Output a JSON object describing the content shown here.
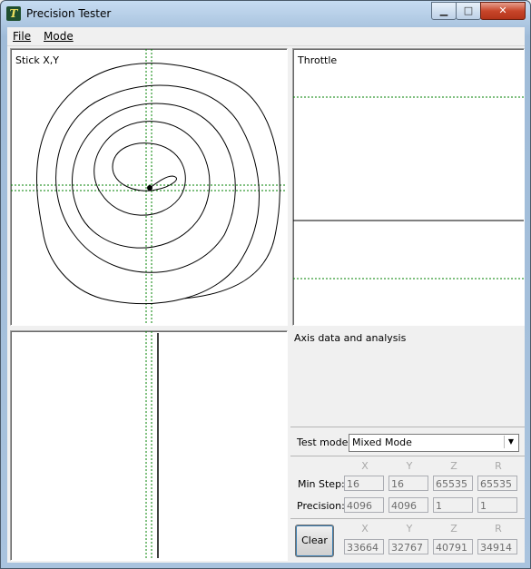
{
  "window": {
    "title": "Precision Tester",
    "icon": "app-icon",
    "caption_buttons": {
      "minimize": "▁",
      "maximize": "□",
      "close": "✕"
    }
  },
  "menu": {
    "file": "File",
    "mode": "Mode"
  },
  "panels": {
    "stick": {
      "label": "Stick X,Y"
    },
    "throttle": {
      "label": "Throttle"
    },
    "analysis": {
      "label": "Axis data and analysis"
    }
  },
  "test_mode": {
    "label": "Test mode:",
    "value": "Mixed Mode"
  },
  "stats": {
    "columns": [
      "X",
      "Y",
      "Z",
      "R"
    ],
    "min_step": {
      "label": "Min Step:",
      "values": [
        "16",
        "16",
        "65535",
        "65535"
      ]
    },
    "precision": {
      "label": "Precision:",
      "values": [
        "4096",
        "4096",
        "1",
        "1"
      ]
    }
  },
  "raw": {
    "columns": [
      "X",
      "Y",
      "Z",
      "R"
    ],
    "values": [
      "33664",
      "32767",
      "40791",
      "34914"
    ]
  },
  "clear_button": "Clear",
  "colors": {
    "guide": "#008000",
    "trace": "#000000",
    "selection": "#3c7fb1"
  }
}
